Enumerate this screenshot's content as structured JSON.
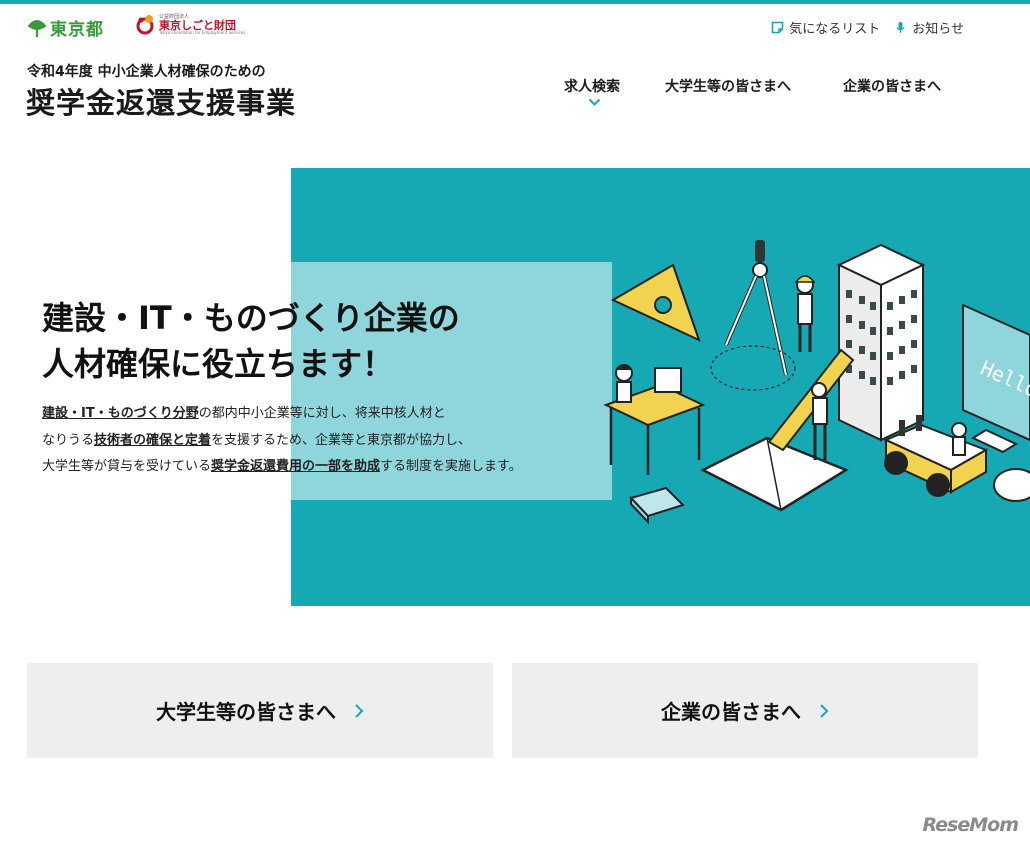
{
  "brand": {
    "tokyo_logo": "東京都",
    "foundation_small": "公益財団法人",
    "foundation_name": "東京しごと財団",
    "foundation_eng": "Tokyo Foundation for Employment Services"
  },
  "top_links": {
    "favorites": "気になるリスト",
    "notices": "お知らせ"
  },
  "header": {
    "subtitle": "令和4年度 中小企業人材確保のための",
    "title": "奨学金返還支援事業"
  },
  "nav": {
    "job_search": "求人検索",
    "students": "大学生等の皆さまへ",
    "companies": "企業の皆さまへ"
  },
  "hero": {
    "title_line1": "建設・IT・ものづくり企業の",
    "title_line2": "人材確保に役立ちます！",
    "desc_1a": "建設・IT・ものづくり分野",
    "desc_1b": "の都内中小企業等に対し、将来中核人材と",
    "desc_2a": "なりうる",
    "desc_2b": "技術者の確保と定着",
    "desc_2c": "を支援するため、企業等と東京都が協力し、",
    "desc_3a": "大学生等が貸与を受けている",
    "desc_3b": "奨学金返還費用の一部を助成",
    "desc_3c": "する制度を実施します。",
    "monitor_text": "Hello"
  },
  "cards": {
    "students": "大学生等の皆さまへ",
    "companies": "企業の皆さまへ"
  },
  "watermark": "ReseMom",
  "colors": {
    "accent": "#17a9b3",
    "panel": "#8fd6dc",
    "card_bg": "#eeeeee",
    "tokyo_green": "#3a9a3a",
    "foundation_red": "#c0122e"
  }
}
